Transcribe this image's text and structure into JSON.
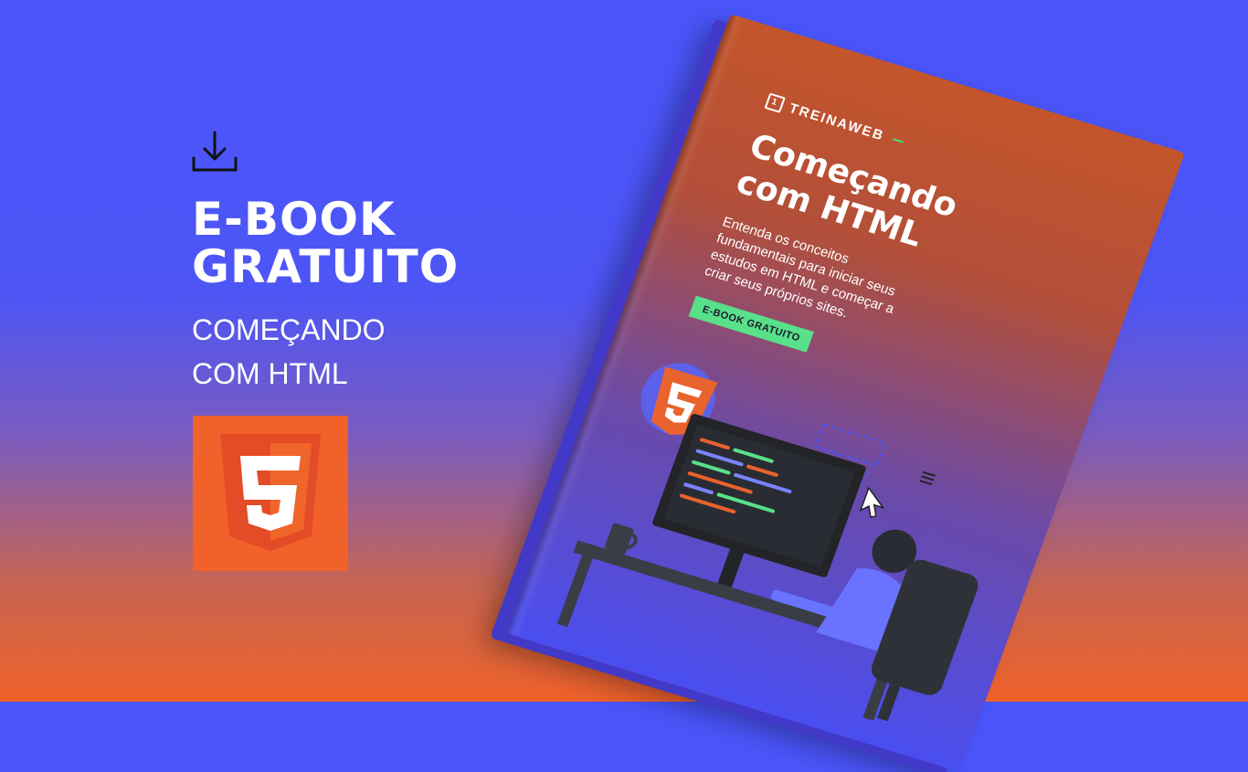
{
  "hero": {
    "headline_line1": "E-BOOK",
    "headline_line2": "GRATUITO",
    "subtitle_line1": "COMEÇANDO",
    "subtitle_line2": "COM HTML",
    "download_icon": "download-icon",
    "logo_icon": "html5-icon"
  },
  "book": {
    "brand": "TREINAWEB",
    "title_line1": "Começando",
    "title_line2": "com HTML",
    "description": "Entenda os conceitos fundamentais para iniciar seus estudos em HTML e começar a criar seus próprios sites.",
    "badge": "E-BOOK GRATUITO",
    "illustration": "developer-at-computer-illustration"
  },
  "colors": {
    "background_top": "#4a55fb",
    "background_bottom": "#f0622a",
    "html5_orange": "#f0622a",
    "badge_green": "#59e08a"
  }
}
